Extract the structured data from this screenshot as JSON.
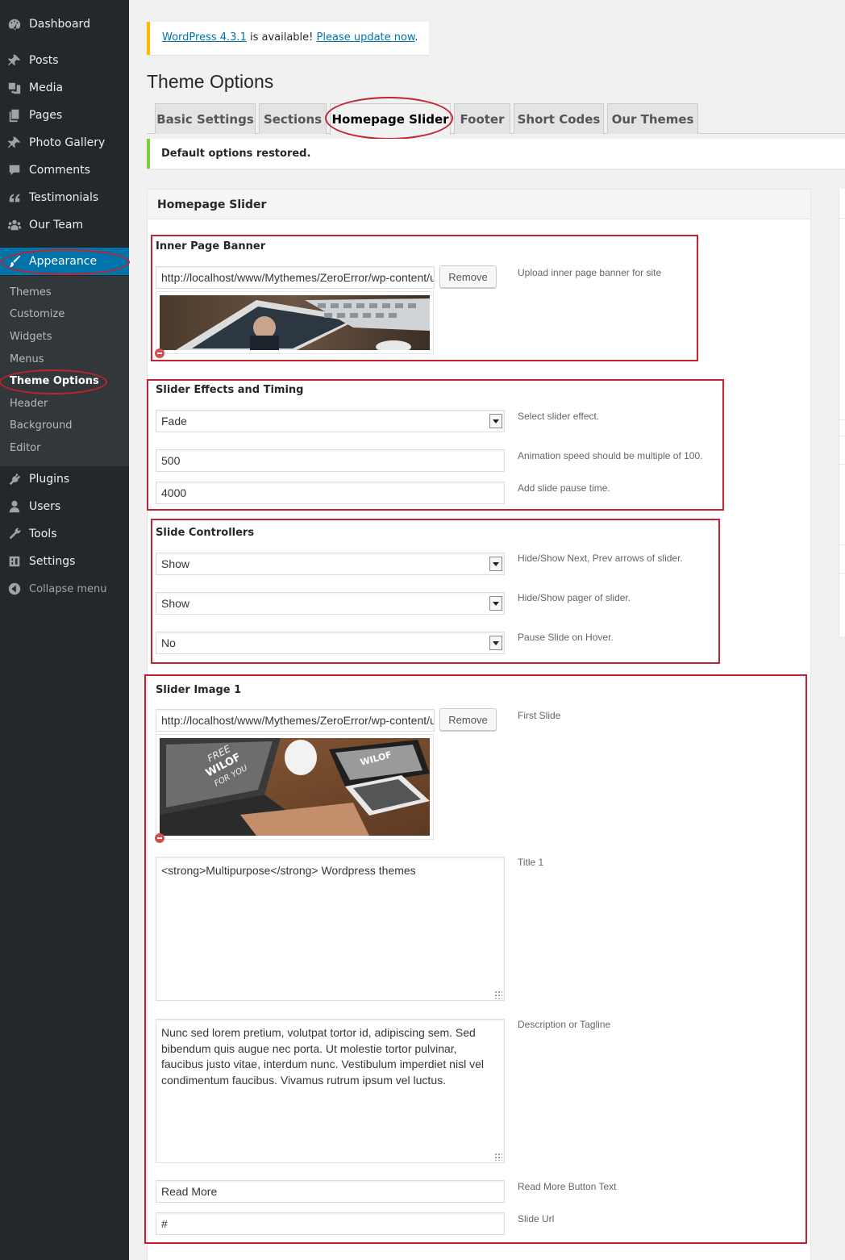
{
  "sidebar": {
    "menu": [
      {
        "label": "Dashboard",
        "icon": "dashboard-icon"
      },
      {
        "label": "Posts",
        "icon": "pin-icon"
      },
      {
        "label": "Media",
        "icon": "media-icon"
      },
      {
        "label": "Pages",
        "icon": "pages-icon"
      },
      {
        "label": "Photo Gallery",
        "icon": "pin-icon"
      },
      {
        "label": "Comments",
        "icon": "comment-icon"
      },
      {
        "label": "Testimonials",
        "icon": "quote-icon"
      },
      {
        "label": "Our Team",
        "icon": "team-icon"
      },
      {
        "label": "Appearance",
        "icon": "brush-icon"
      }
    ],
    "submenu": [
      "Themes",
      "Customize",
      "Widgets",
      "Menus",
      "Theme Options",
      "Header",
      "Background",
      "Editor"
    ],
    "menu_after": [
      {
        "label": "Plugins",
        "icon": "plugin-icon"
      },
      {
        "label": "Users",
        "icon": "user-icon"
      },
      {
        "label": "Tools",
        "icon": "wrench-icon"
      },
      {
        "label": "Settings",
        "icon": "settings-icon"
      }
    ],
    "collapse_label": "Collapse menu"
  },
  "notice": {
    "link_version": "WordPress 4.3.1",
    "middle_text": " is available! ",
    "link_update": "Please update now",
    "end_text": "."
  },
  "page_title": "Theme Options",
  "tabs": [
    "Basic Settings",
    "Sections",
    "Homepage Slider",
    "Footer",
    "Short Codes",
    "Our Themes"
  ],
  "active_tab": "Homepage Slider",
  "restored_message": "Default options restored.",
  "panel_title": "Homepage Slider",
  "inner_banner": {
    "title": "Inner Page Banner",
    "url": "http://localhost/www/Mythemes/ZeroError/wp-content/uploads/banner.jpg",
    "remove_label": "Remove",
    "desc": "Upload inner page banner for site"
  },
  "effects": {
    "title": "Slider Effects and Timing",
    "effect": "Fade",
    "effect_desc": "Select slider effect.",
    "speed": "500",
    "speed_desc": "Animation speed should be multiple of 100.",
    "pause": "4000",
    "pause_desc": "Add slide pause time."
  },
  "controllers": {
    "title": "Slide Controllers",
    "arrows": "Show",
    "arrows_desc": "Hide/Show Next, Prev arrows of slider.",
    "pager": "Show",
    "pager_desc": "Hide/Show pager of slider.",
    "hover_pause": "No",
    "hover_pause_desc": "Pause Slide on Hover."
  },
  "slide1": {
    "title": "Slider Image 1",
    "url": "http://localhost/www/Mythemes/ZeroError/wp-content/uploads/slide1.jpg",
    "remove_label": "Remove",
    "image_desc": "First Slide",
    "title_value": "<strong>Multipurpose</strong> Wordpress themes",
    "title_desc": "Title 1",
    "description_value": "Nunc sed lorem pretium, volutpat tortor id, adipiscing sem. Sed bibendum quis augue nec porta. Ut molestie tortor pulvinar, faucibus justo vitae, interdum nunc. Vestibulum imperdiet nisl vel condimentum faucibus. Vivamus rutrum ipsum vel luctus.",
    "description_desc": "Description or Tagline",
    "button_text": "Read More",
    "button_text_desc": "Read More Button Text",
    "slide_url": "#",
    "slide_url_desc": "Slide Url"
  },
  "colors": {
    "sidebar_bg": "#23282d",
    "submenu_bg": "#32373c",
    "accent": "#0073aa",
    "annotation": "#c0222e",
    "update_notice": "#ffba00",
    "success_notice": "#7ad03a"
  }
}
